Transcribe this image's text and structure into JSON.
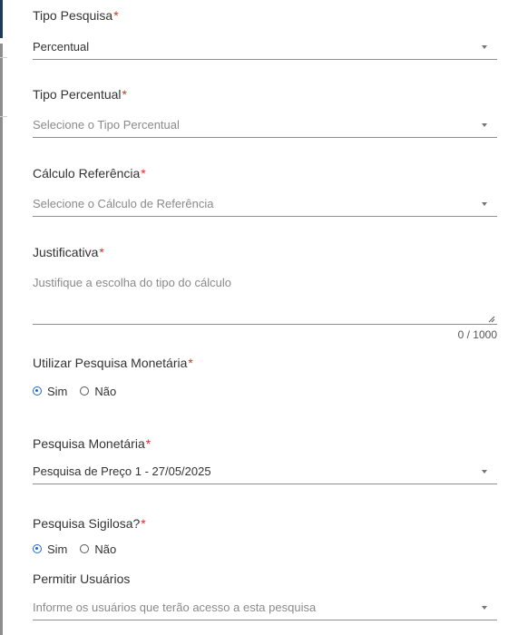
{
  "form": {
    "tipo_pesquisa": {
      "label": "Tipo Pesquisa",
      "required_mark": "*",
      "value": "Percentual"
    },
    "tipo_percentual": {
      "label": "Tipo Percentual",
      "required_mark": "*",
      "placeholder": "Selecione o Tipo Percentual"
    },
    "calculo_referencia": {
      "label": "Cálculo Referência",
      "required_mark": "*",
      "placeholder": "Selecione o Cálculo de Referência"
    },
    "justificativa": {
      "label": "Justificativa",
      "required_mark": "*",
      "placeholder": "Justifique a escolha do tipo do cálculo",
      "counter": "0 / 1000"
    },
    "utilizar_pesquisa_monetaria": {
      "label": "Utilizar Pesquisa Monetária",
      "required_mark": "*",
      "options": [
        "Sim",
        "Não"
      ],
      "selected": "Sim"
    },
    "pesquisa_monetaria": {
      "label": "Pesquisa Monetária",
      "required_mark": "*",
      "value": "Pesquisa de Preço 1 - 27/05/2025"
    },
    "pesquisa_sigilosa": {
      "label": "Pesquisa Sigilosa?",
      "required_mark": "*",
      "options": [
        "Sim",
        "Não"
      ],
      "selected": "Sim"
    },
    "permitir_usuarios": {
      "label": "Permitir Usuários",
      "placeholder": "Informe os usuários que terão acesso a esta pesquisa"
    }
  },
  "colors": {
    "accent": "#1f68c9",
    "required": "#d93025",
    "sidebar_accent": "#1b3a5c"
  },
  "icons": {
    "dropdown": "chevron-down-icon",
    "radio_checked": "radio-checked-icon",
    "radio_unchecked": "radio-unchecked-icon",
    "resize": "resize-grip-icon"
  }
}
